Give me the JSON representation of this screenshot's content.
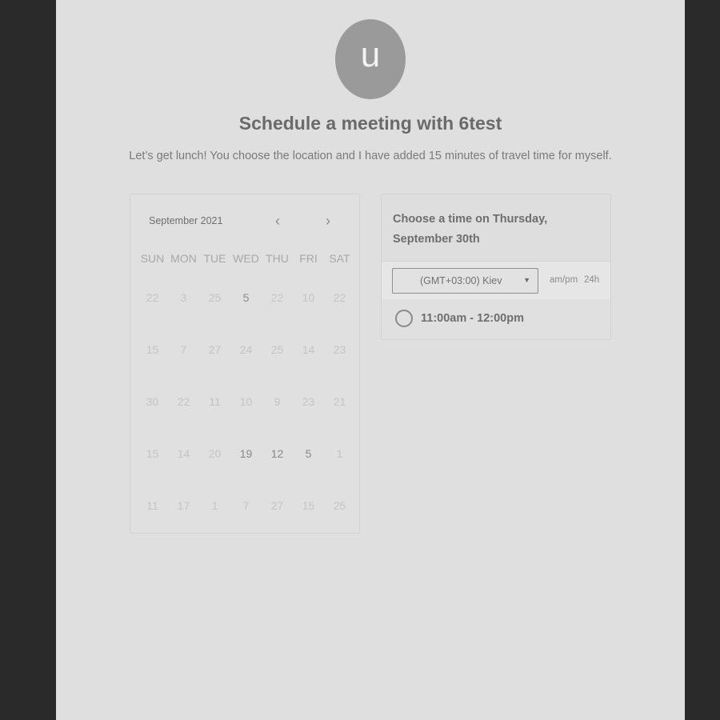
{
  "header": {
    "avatar_initial": "u",
    "title": "Schedule a meeting with 6test",
    "subtitle": "Let’s get lunch! You choose the location and I have added 15 minutes of travel time for myself."
  },
  "calendar": {
    "month_label": "September 2021",
    "prev_icon": "chevron-left-icon",
    "next_icon": "chevron-right-icon",
    "weekdays": [
      "SUN",
      "MON",
      "TUE",
      "WED",
      "THU",
      "FRI",
      "SAT"
    ],
    "weeks": [
      [
        "22",
        "3",
        "25",
        "5",
        "22",
        "10",
        "22"
      ],
      [
        "15",
        "7",
        "27",
        "24",
        "25",
        "14",
        "23"
      ],
      [
        "30",
        "22",
        "11",
        "10",
        "9",
        "23",
        "21"
      ],
      [
        "15",
        "14",
        "20",
        "19",
        "12",
        "5",
        "1"
      ],
      [
        "11",
        "17",
        "1",
        "7",
        "27",
        "15",
        "25"
      ]
    ],
    "active_days": [
      [
        0,
        3
      ],
      [
        3,
        3
      ],
      [
        3,
        4
      ],
      [
        3,
        5
      ]
    ]
  },
  "slots": {
    "title": "Choose a time on Thursday, September 30th",
    "timezone": "(GMT+03:00) Kiev",
    "caret_icon": "caret-down-icon",
    "format_ampm": "am/pm",
    "format_24h": "24h",
    "times": [
      "11:00am - 12:00pm"
    ]
  }
}
